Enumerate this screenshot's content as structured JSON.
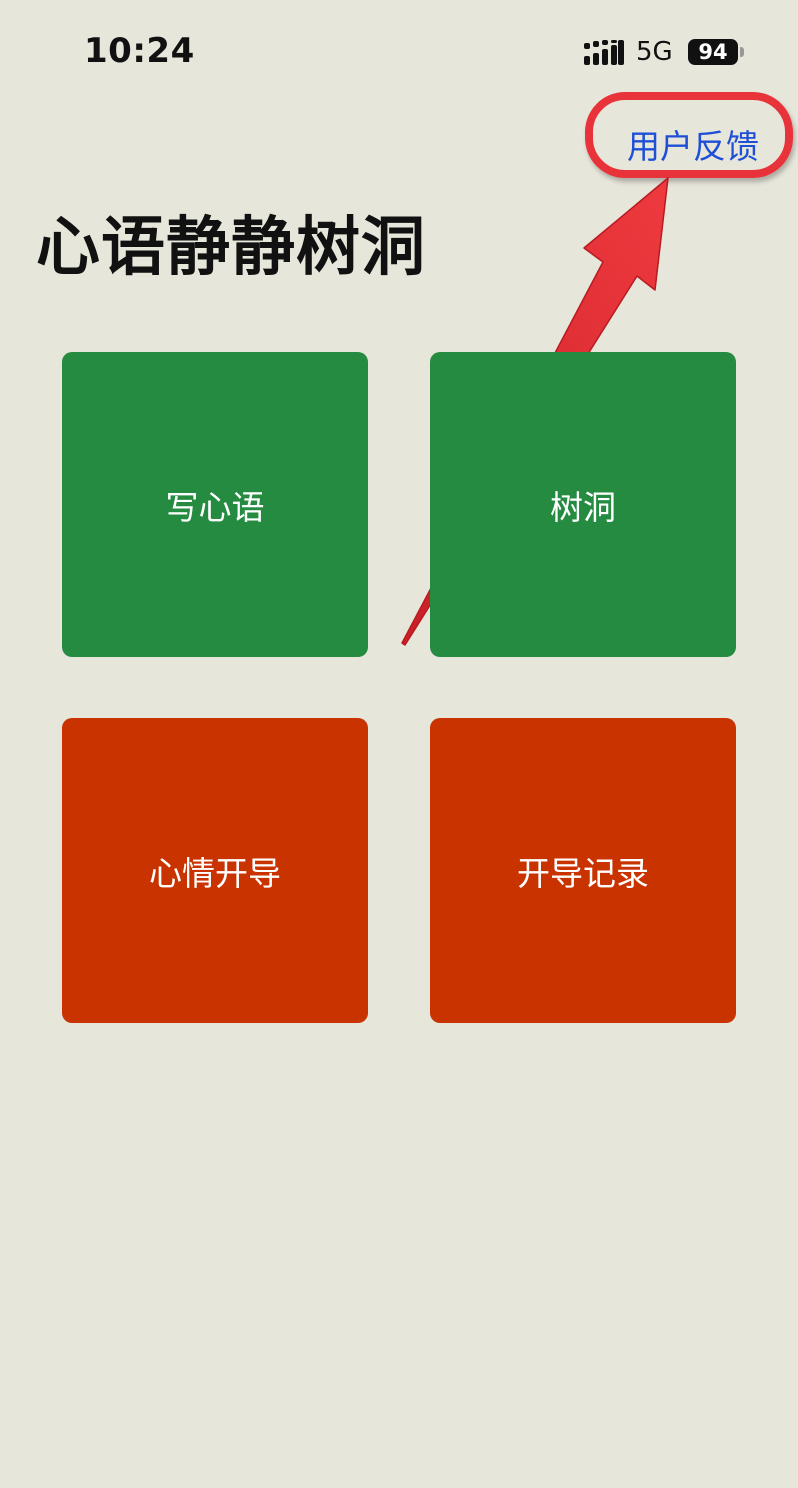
{
  "status_bar": {
    "time": "10:24",
    "network": "5G",
    "battery": "94"
  },
  "header": {
    "feedback_label": "用户反馈"
  },
  "page_title": "心语静静树洞",
  "tiles": [
    {
      "label": "写心语",
      "color": "#248b41"
    },
    {
      "label": "树洞",
      "color": "#248b41"
    },
    {
      "label": "心情开导",
      "color": "#c93300"
    },
    {
      "label": "开导记录",
      "color": "#c93300"
    }
  ],
  "annotation": {
    "highlight_color": "#e8333a"
  }
}
